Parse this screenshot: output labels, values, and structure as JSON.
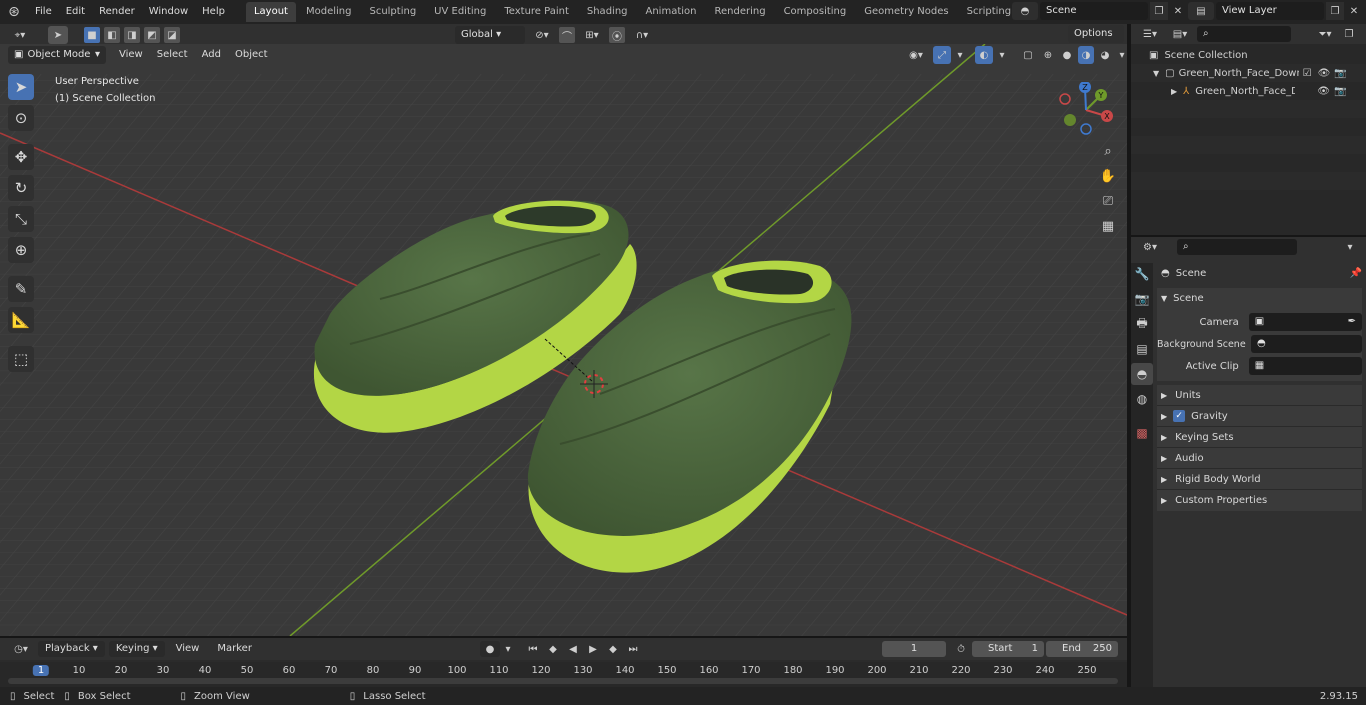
{
  "menubar": {
    "items": [
      "File",
      "Edit",
      "Render",
      "Window",
      "Help"
    ]
  },
  "workspaces": [
    "Layout",
    "Modeling",
    "Sculpting",
    "UV Editing",
    "Texture Paint",
    "Shading",
    "Animation",
    "Rendering",
    "Compositing",
    "Geometry Nodes",
    "Scripting"
  ],
  "active_workspace": "Layout",
  "scene_name": "Scene",
  "view_layer": "View Layer",
  "tool_header": {
    "orientation": "Global",
    "options": "Options"
  },
  "viewport_header": {
    "mode": "Object Mode",
    "menus": [
      "View",
      "Select",
      "Add",
      "Object"
    ]
  },
  "viewport": {
    "perspective": "User Perspective",
    "collection": "(1) Scene Collection"
  },
  "gizmo": {
    "x": "X",
    "y": "Y",
    "z": "Z"
  },
  "outliner": {
    "root": "Scene Collection",
    "items": [
      {
        "label": "Green_North_Face_Down_Slip"
      },
      {
        "label": "Green_North_Face_Dowr"
      }
    ]
  },
  "properties": {
    "context": "Scene",
    "panel": "Scene",
    "fields": {
      "camera": "Camera",
      "background_scene": "Background Scene",
      "active_clip": "Active Clip"
    },
    "sections": [
      "Units",
      "Gravity",
      "Keying Sets",
      "Audio",
      "Rigid Body World",
      "Custom Properties"
    ],
    "gravity_checked": true
  },
  "timeline": {
    "menus": [
      "Playback",
      "Keying",
      "View",
      "Marker"
    ],
    "current_frame": "1",
    "start_label": "Start",
    "start_value": "1",
    "end_label": "End",
    "end_value": "250",
    "ticks": [
      "1",
      "10",
      "20",
      "30",
      "40",
      "50",
      "60",
      "70",
      "80",
      "90",
      "100",
      "110",
      "120",
      "130",
      "140",
      "150",
      "160",
      "170",
      "180",
      "190",
      "200",
      "210",
      "220",
      "230",
      "240",
      "250"
    ]
  },
  "statusbar": {
    "select": "Select",
    "box_select": "Box Select",
    "zoom_view": "Zoom View",
    "lasso_select": "Lasso Select",
    "version": "2.93.15"
  },
  "colors": {
    "accent": "#4772b3",
    "slipper_upper": "#4f6a3c",
    "slipper_sole": "#b3d645",
    "x_axis": "#b03a3a",
    "y_axis": "#6f9a2a"
  }
}
